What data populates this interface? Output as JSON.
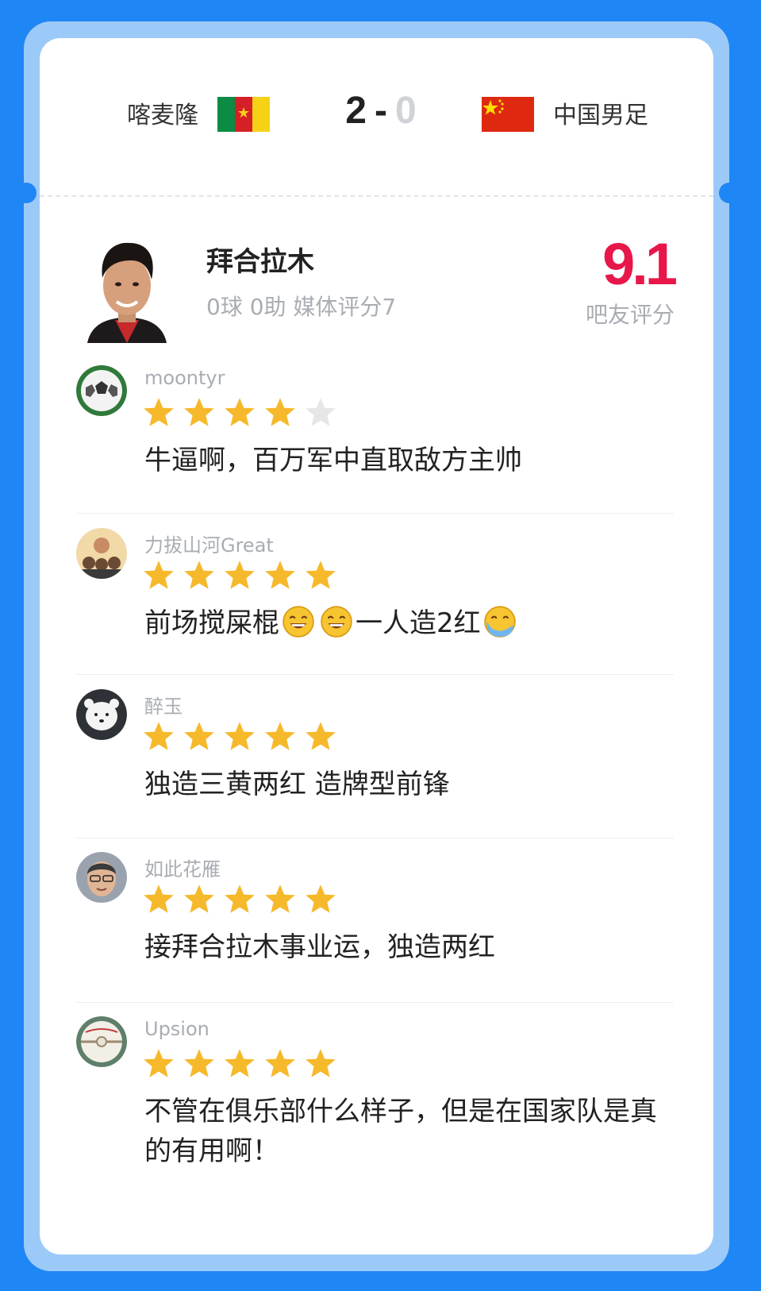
{
  "match": {
    "home_team": "喀麦隆",
    "away_team": "中国男足",
    "home_score": "2",
    "separator": "-",
    "away_score": "0"
  },
  "player": {
    "name": "拜合拉木",
    "stats": "0球 0助 媒体评分7",
    "rating": "9.1",
    "rating_label": "吧友评分"
  },
  "colors": {
    "rating": "#e8174a",
    "star_filled": "#f6b92b",
    "star_empty": "#e6e6e6",
    "background": "#1f86f5"
  },
  "comments": [
    {
      "user": "moontyr",
      "stars": 4,
      "text": "牛逼啊，百万军中直取敌方主帅"
    },
    {
      "user": "力拔山河Great",
      "stars": 5,
      "text_parts": [
        "前场搅屎棍",
        "一人造2红"
      ],
      "emojis": [
        "grin-emoji",
        "grin-emoji",
        "sweat-emoji"
      ]
    },
    {
      "user": "醉玉",
      "stars": 5,
      "text": "独造三黄两红 造牌型前锋"
    },
    {
      "user": "如此花雁",
      "stars": 5,
      "text": "接拜合拉木事业运，独造两红"
    },
    {
      "user": "Upsion",
      "stars": 5,
      "text": "不管在俱乐部什么样子，但是在国家队是真的有用啊！"
    }
  ]
}
